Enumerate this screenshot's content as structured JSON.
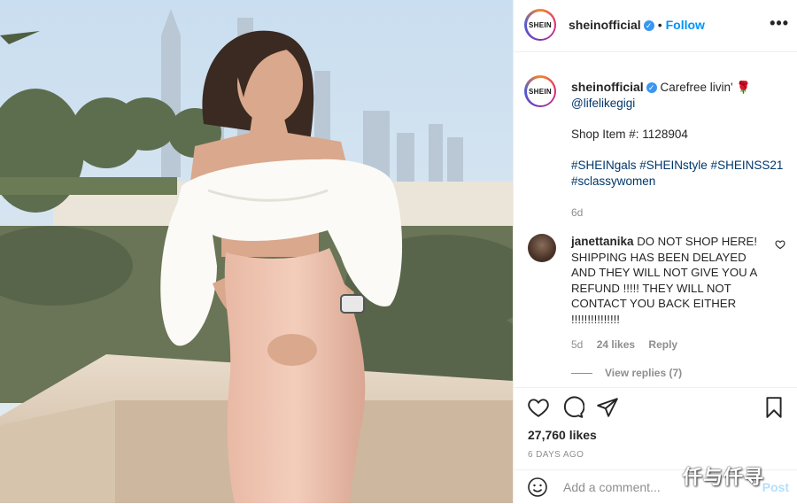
{
  "post": {
    "username": "sheinofficial",
    "avatar_text": "SHEIN",
    "follow_label": "Follow",
    "more_label": "•••",
    "verified_icon": "verified-badge-icon",
    "caption": {
      "text": "Carefree livin'",
      "emoji": "🌹",
      "mention": "@lifelikegigi",
      "shop_item": "Shop Item #: 1128904",
      "hashtags_line1": "#SHEINgals #SHEINstyle #SHEINSS21",
      "hashtags_line2": "#sclassywomen",
      "age": "6d"
    },
    "comment": {
      "username": "janettanika",
      "text": "DO NOT SHOP HERE! SHIPPING HAS BEEN DELAYED AND THEY WILL NOT GIVE YOU A REFUND !!!!! THEY WILL NOT CONTACT YOU BACK EITHER !!!!!!!!!!!!!!!",
      "age": "5d",
      "likes": "24 likes",
      "reply_label": "Reply",
      "view_replies": "View replies (7)"
    },
    "likes": "27,760 likes",
    "timestamp": "6 DAYS AGO",
    "comment_placeholder": "Add a comment...",
    "post_label": "Post"
  },
  "watermark": "仟与仟寻",
  "colors": {
    "follow": "#0095f6",
    "verified": "#3897f0",
    "muted": "#8e8e8e",
    "post_disabled": "#b2dffc",
    "link": "#00376b"
  }
}
